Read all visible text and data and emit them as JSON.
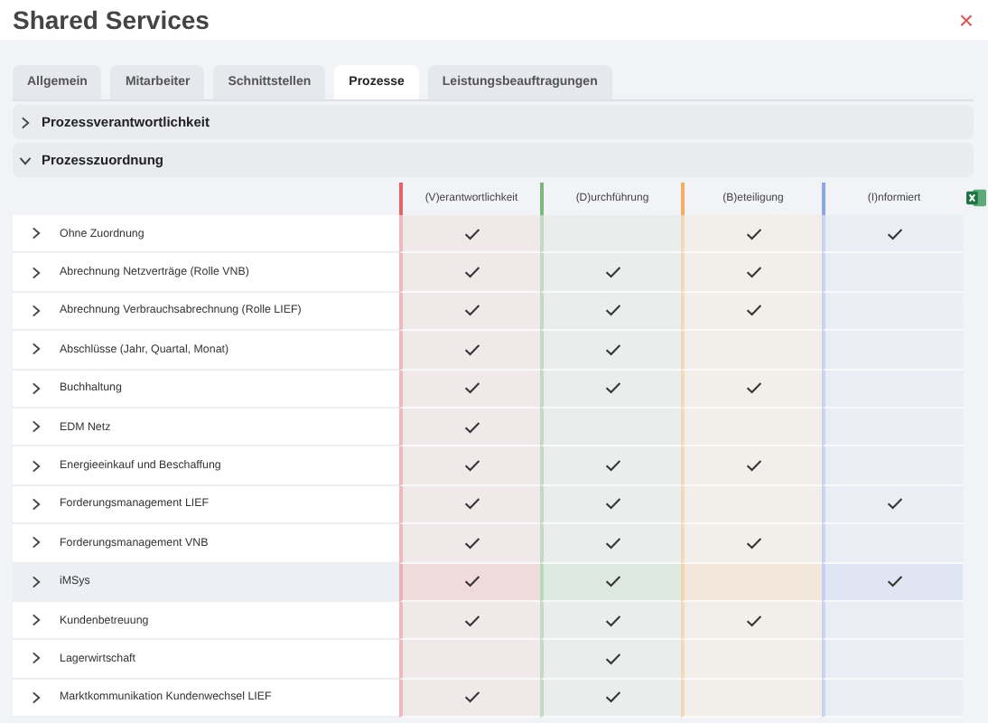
{
  "window": {
    "title": "Shared Services",
    "close": "×"
  },
  "tabs": [
    {
      "label": "Allgemein",
      "selected": false
    },
    {
      "label": "Mitarbeiter",
      "selected": false
    },
    {
      "label": "Schnittstellen",
      "selected": false
    },
    {
      "label": "Prozesse",
      "selected": true
    },
    {
      "label": "Leistungsbeauftragungen",
      "selected": false
    }
  ],
  "sections": [
    {
      "title": "Prozessverantwortlichkeit",
      "expanded": false
    },
    {
      "title": "Prozesszuordnung",
      "expanded": true
    }
  ],
  "table": {
    "columns": [
      {
        "label": "(V)erantwortlichkeit",
        "color": "#e06666"
      },
      {
        "label": "(D)urchführung",
        "color": "#7cb87a"
      },
      {
        "label": "(B)eteiligung",
        "color": "#f0b060"
      },
      {
        "label": "(I)nformiert",
        "color": "#8fa6e6"
      }
    ],
    "rows": [
      {
        "name": "Ohne Zuordnung",
        "highlighted": false,
        "checks": [
          true,
          false,
          true,
          true
        ]
      },
      {
        "name": "Abrechnung Netzverträge (Rolle VNB)",
        "highlighted": false,
        "checks": [
          true,
          true,
          true,
          false
        ]
      },
      {
        "name": "Abrechnung Verbrauchsabrechnung (Rolle LIEF)",
        "highlighted": false,
        "checks": [
          true,
          true,
          true,
          false
        ]
      },
      {
        "name": "Abschlüsse (Jahr, Quartal, Monat)",
        "highlighted": false,
        "checks": [
          true,
          true,
          false,
          false
        ]
      },
      {
        "name": "Buchhaltung",
        "highlighted": false,
        "checks": [
          true,
          true,
          true,
          false
        ]
      },
      {
        "name": "EDM Netz",
        "highlighted": false,
        "checks": [
          true,
          false,
          false,
          false
        ]
      },
      {
        "name": "Energieeinkauf und Beschaffung",
        "highlighted": false,
        "checks": [
          true,
          true,
          true,
          false
        ]
      },
      {
        "name": "Forderungsmanagement LIEF",
        "highlighted": false,
        "checks": [
          true,
          true,
          false,
          true
        ]
      },
      {
        "name": "Forderungsmanagement VNB",
        "highlighted": false,
        "checks": [
          true,
          true,
          true,
          false
        ]
      },
      {
        "name": "iMSys",
        "highlighted": true,
        "checks": [
          true,
          true,
          false,
          true
        ]
      },
      {
        "name": "Kundenbetreuung",
        "highlighted": false,
        "checks": [
          true,
          true,
          true,
          false
        ]
      },
      {
        "name": "Lagerwirtschaft",
        "highlighted": false,
        "checks": [
          false,
          true,
          false,
          false
        ]
      },
      {
        "name": "Marktkommunikation Kundenwechsel LIEF",
        "highlighted": false,
        "checks": [
          true,
          true,
          false,
          false
        ]
      }
    ]
  }
}
